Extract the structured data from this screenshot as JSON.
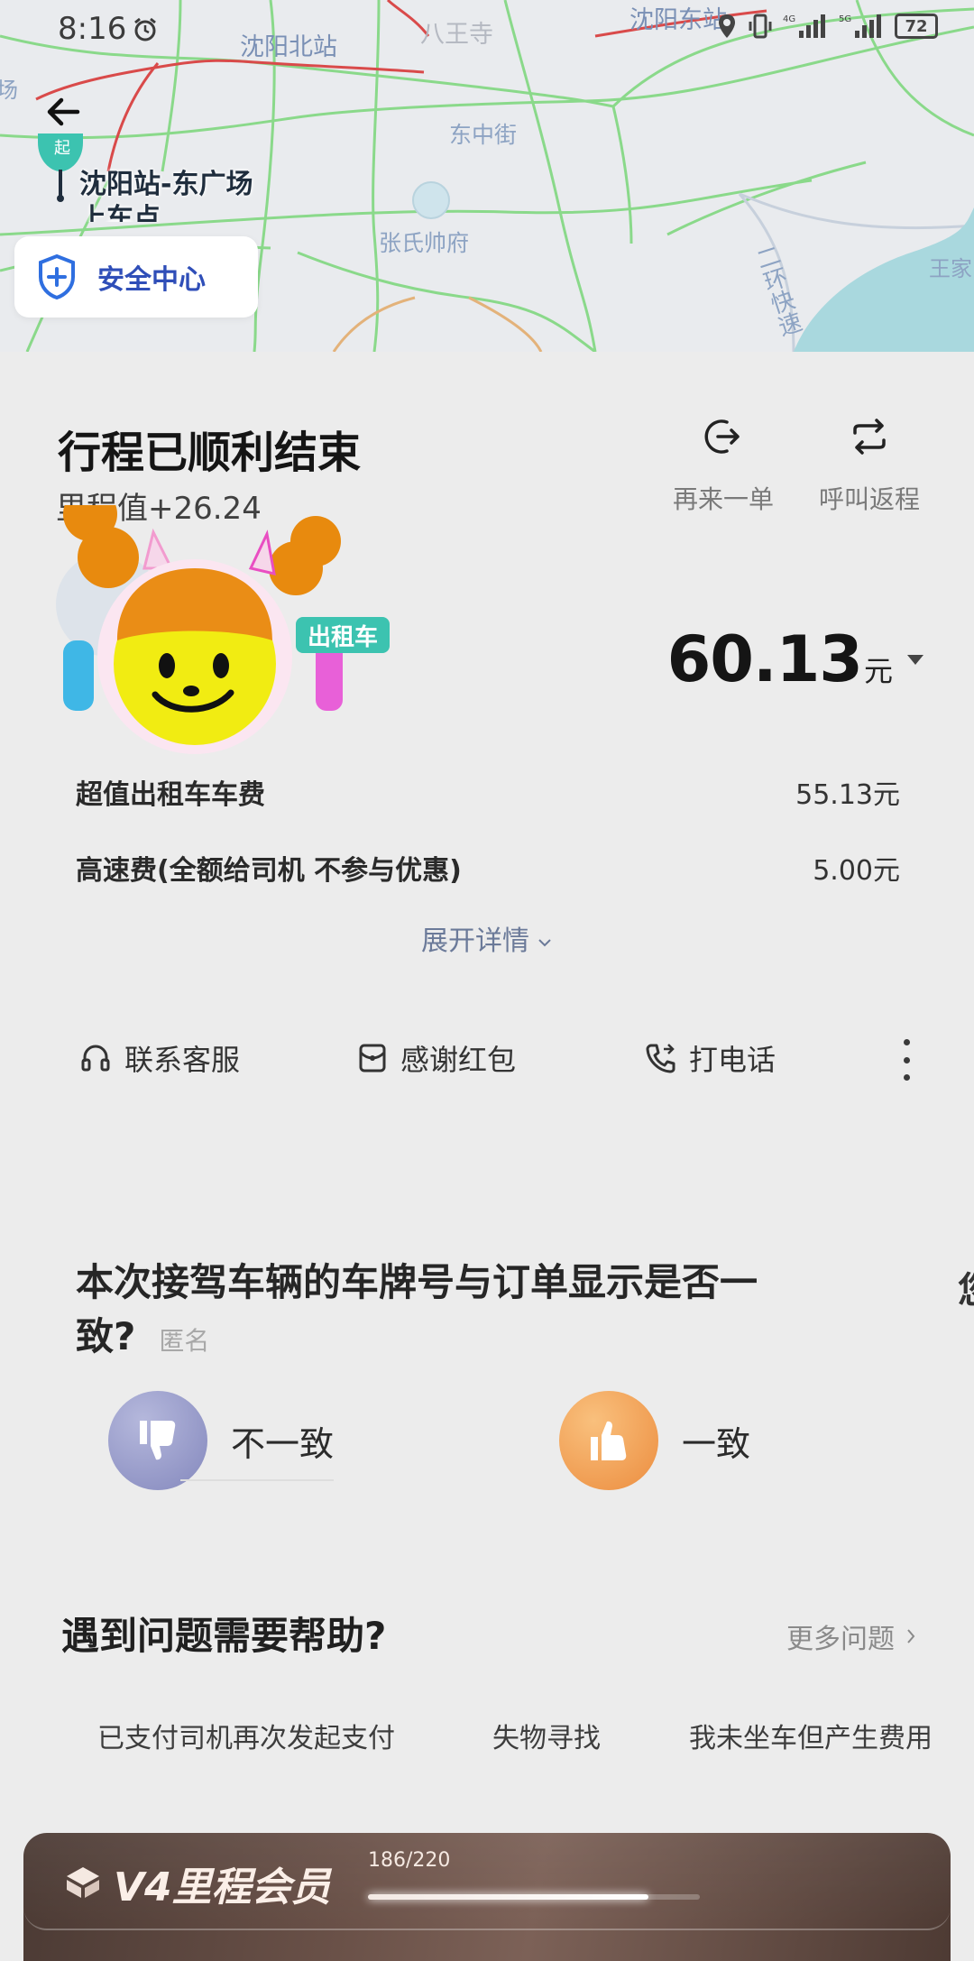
{
  "status_bar": {
    "time": "8:16",
    "battery": "72"
  },
  "map": {
    "labels": {
      "north_station": "沈阳北站",
      "bawangsi": "八王寺",
      "east_station": "沈阳东站",
      "dongzhongjie": "东中街",
      "zhangshi": "张氏帅府",
      "edge_left": "场",
      "edge_right": "王家",
      "ring_road": "二环快速"
    },
    "pickup": {
      "line1": "沈阳站-东广场",
      "line2": "上车点"
    },
    "safety_center": "安全中心"
  },
  "trip": {
    "title": "行程已顺利结束",
    "mileage": "里程值+26.24",
    "actions": {
      "again": "再来一单",
      "return": "呼叫返程"
    },
    "badge": "出租车",
    "price": {
      "amount": "60.13",
      "unit": "元"
    },
    "fees": [
      {
        "name": "超值出租车车费",
        "value": "55.13元"
      },
      {
        "name": "高速费(全额给司机 不参与优惠)",
        "value": "5.00元"
      }
    ],
    "expand": "展开详情"
  },
  "toolbar": {
    "service": "联系客服",
    "thanks": "感谢红包",
    "call": "打电话"
  },
  "survey": {
    "question": "本次接驾车辆的车牌号与订单显示是否一致?",
    "anonymous": "匿名",
    "peek": "您",
    "no": "不一致",
    "yes": "一致"
  },
  "help": {
    "title": "遇到问题需要帮助?",
    "more": "更多问题",
    "chips": [
      "已支付司机再次发起支付",
      "失物寻找",
      "我未坐车但产生费用"
    ]
  },
  "membership": {
    "title": "V4里程会员",
    "progress_text": "186/220",
    "progress": 0.845
  },
  "colors": {
    "accent": "#2f4eb8",
    "taxi_badge": "#3cc3b0",
    "road_green": "#7fd67f",
    "road_red": "#d94a4a"
  }
}
